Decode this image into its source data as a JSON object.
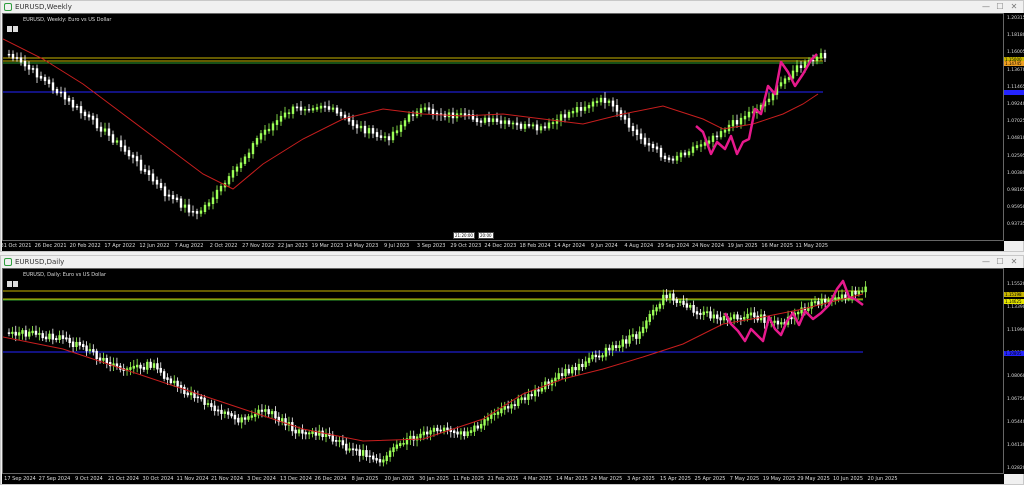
{
  "weekly": {
    "title": "EURUSD,Weekly",
    "symbol_label": "EURUSD, Weekly: Euro vs US Dollar",
    "buttons": {
      "minimize": "—",
      "maximize": "☐",
      "close": "✕"
    },
    "price_labels": [
      "1.20315",
      "1.18180",
      "1.16005",
      "1.13670",
      "1.11465",
      "1.09240",
      "1.07025",
      "1.04810",
      "1.02595",
      "1.00380",
      "0.98165",
      "0.95950",
      "0.93735"
    ],
    "price_tags": {
      "upper": "1.15000",
      "current": "1.14745"
    },
    "time_labels": [
      "31 Oct 2021",
      "26 Dec 2021",
      "20 Feb 2022",
      "17 Apr 2022",
      "12 Jun 2022",
      "7 Aug 2022",
      "2 Oct 2022",
      "27 Nov 2022",
      "22 Jan 2023",
      "19 Mar 2023",
      "14 May 2023",
      "9 Jul 2023",
      "3 Sep 2023",
      "29 Oct 2023",
      "24 Dec 2023",
      "18 Feb 2024",
      "14 Apr 2024",
      "9 Jun 2024",
      "4 Aug 2024",
      "29 Sep 2024",
      "24 Nov 2024",
      "19 Jan 2025",
      "16 Mar 2025",
      "11 May 2025"
    ],
    "crosshair_labels": [
      "21:20:00",
      "20:00"
    ],
    "colors": {
      "bull": "#9cff57",
      "bear": "#ffffff",
      "ma": "#c81e1e",
      "pattern": "#e6198c",
      "hblue": "#2424ff",
      "hyellow": "#c8b400",
      "hgreen": "#2ea02e"
    }
  },
  "daily": {
    "title": "EURUSD,Daily",
    "symbol_label": "EURUSD, Daily: Euro vs US Dollar",
    "buttons": {
      "minimize": "—",
      "maximize": "☐",
      "close": "✕"
    },
    "price_labels": [
      "1.15520",
      "1.13390",
      "1.11990",
      "1.09370",
      "1.08060",
      "1.06750",
      "1.05440",
      "1.04130",
      "1.02820"
    ],
    "price_tags": {
      "upper": "1.15198",
      "current": "1.14625",
      "blue": "1.10805"
    },
    "time_labels": [
      "17 Sep 2024",
      "27 Sep 2024",
      "9 Oct 2024",
      "21 Oct 2024",
      "30 Oct 2024",
      "11 Nov 2024",
      "21 Nov 2024",
      "3 Dec 2024",
      "13 Dec 2024",
      "26 Dec 2024",
      "8 Jan 2025",
      "20 Jan 2025",
      "30 Jan 2025",
      "11 Feb 2025",
      "21 Feb 2025",
      "4 Mar 2025",
      "14 Mar 2025",
      "24 Mar 2025",
      "3 Apr 2025",
      "15 Apr 2025",
      "25 Apr 2025",
      "7 May 2025",
      "19 May 2025",
      "29 May 2025",
      "10 Jun 2025",
      "20 Jun 2025"
    ],
    "colors": {
      "bull": "#9cff57",
      "bear": "#ffffff",
      "ma": "#c81e1e",
      "pattern": "#e6198c",
      "hblue": "#2424ff",
      "hyellow": "#c8b400",
      "hgreen": "#2ea02e"
    }
  }
}
